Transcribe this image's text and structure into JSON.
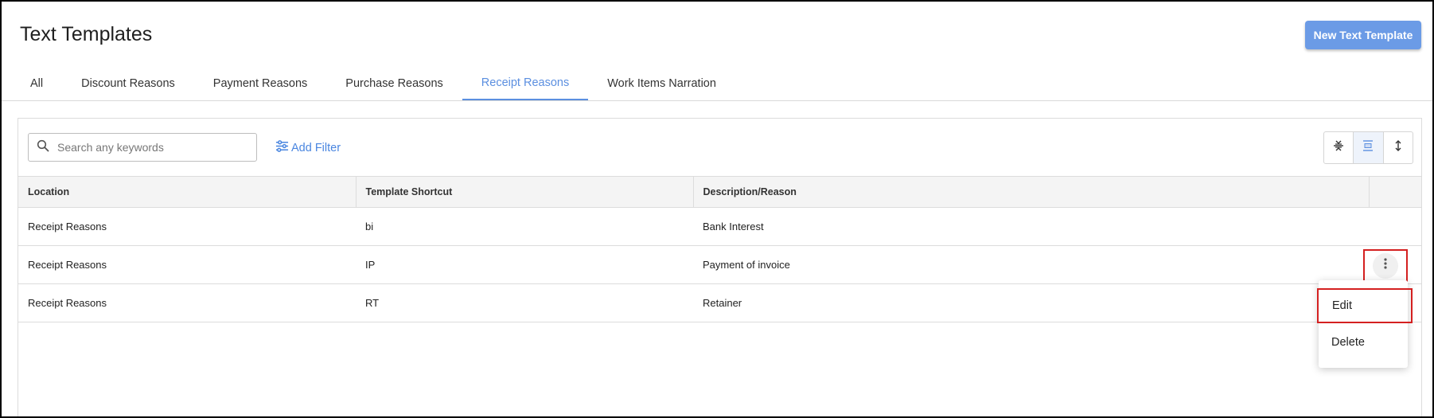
{
  "header": {
    "title": "Text Templates",
    "new_button_label": "New Text Template"
  },
  "tabs": [
    {
      "label": "All",
      "active": false
    },
    {
      "label": "Discount Reasons",
      "active": false
    },
    {
      "label": "Payment Reasons",
      "active": false
    },
    {
      "label": "Purchase Reasons",
      "active": false
    },
    {
      "label": "Receipt Reasons",
      "active": true
    },
    {
      "label": "Work Items Narration",
      "active": false
    }
  ],
  "toolbar": {
    "search_placeholder": "Search any keywords",
    "search_value": "",
    "add_filter_label": "Add Filter",
    "density_icons": [
      "compact-density-icon",
      "standard-density-icon",
      "comfortable-density-icon"
    ],
    "active_density": "standard"
  },
  "table": {
    "columns": [
      "Location",
      "Template Shortcut",
      "Description/Reason",
      ""
    ],
    "rows": [
      {
        "location": "Receipt Reasons",
        "shortcut": "bi",
        "description": "Bank Interest"
      },
      {
        "location": "Receipt Reasons",
        "shortcut": "IP",
        "description": "Payment of invoice"
      },
      {
        "location": "Receipt Reasons",
        "shortcut": "RT",
        "description": "Retainer"
      }
    ]
  },
  "row_menu": {
    "items": [
      "Edit",
      "Delete"
    ]
  },
  "colors": {
    "accent": "#5b8fe0",
    "primary_button": "#6b9be6",
    "highlight_box": "#d42020"
  }
}
